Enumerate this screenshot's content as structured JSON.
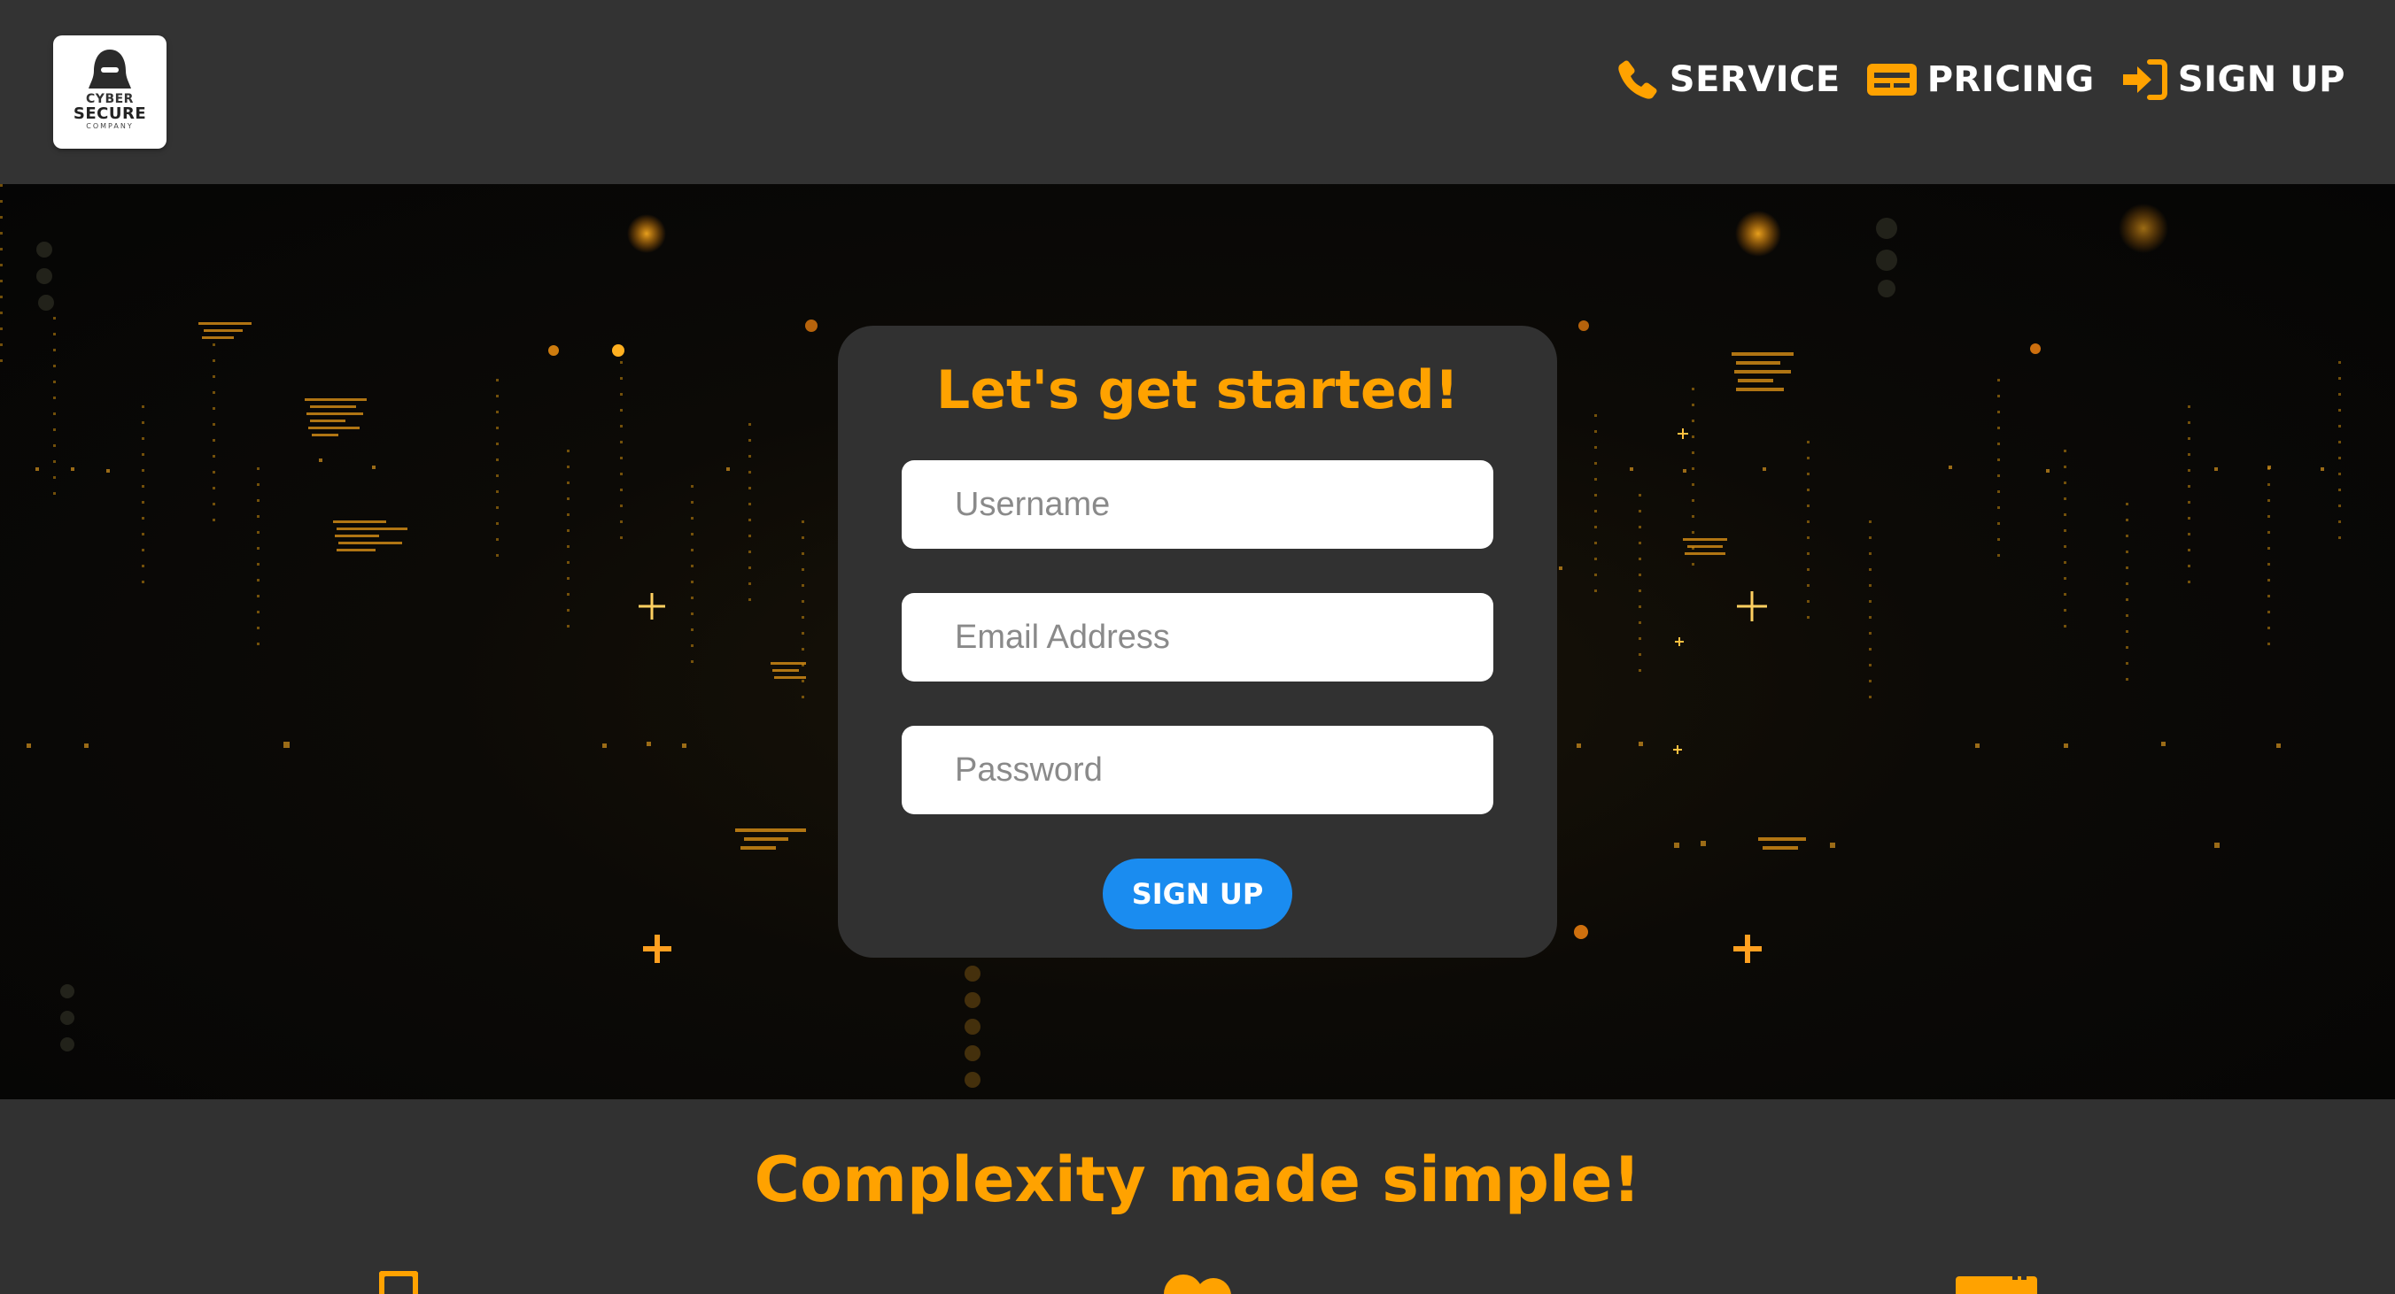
{
  "logo": {
    "line1": "CYBER",
    "line2": "SECURE",
    "line3": "COMPANY"
  },
  "nav": {
    "items": [
      {
        "label": "SERVICE",
        "icon": "phone-icon"
      },
      {
        "label": "PRICING",
        "icon": "credit-card-icon"
      },
      {
        "label": "SIGN UP",
        "icon": "sign-in-icon"
      }
    ]
  },
  "signup_form": {
    "title": "Let's get started!",
    "username_placeholder": "Username",
    "email_placeholder": "Email Address",
    "password_placeholder": "Password",
    "username_value": "",
    "email_value": "",
    "password_value": "",
    "submit_label": "SIGN UP"
  },
  "features": {
    "title": "Complexity made simple!",
    "icons": [
      "mobile-icon",
      "users-icon",
      "calendar-icon"
    ]
  },
  "colors": {
    "accent": "#ffa200",
    "header_bg": "#333333",
    "card_bg": "#313131",
    "button_bg": "#1a8cf0",
    "text_light": "#ffffff"
  }
}
